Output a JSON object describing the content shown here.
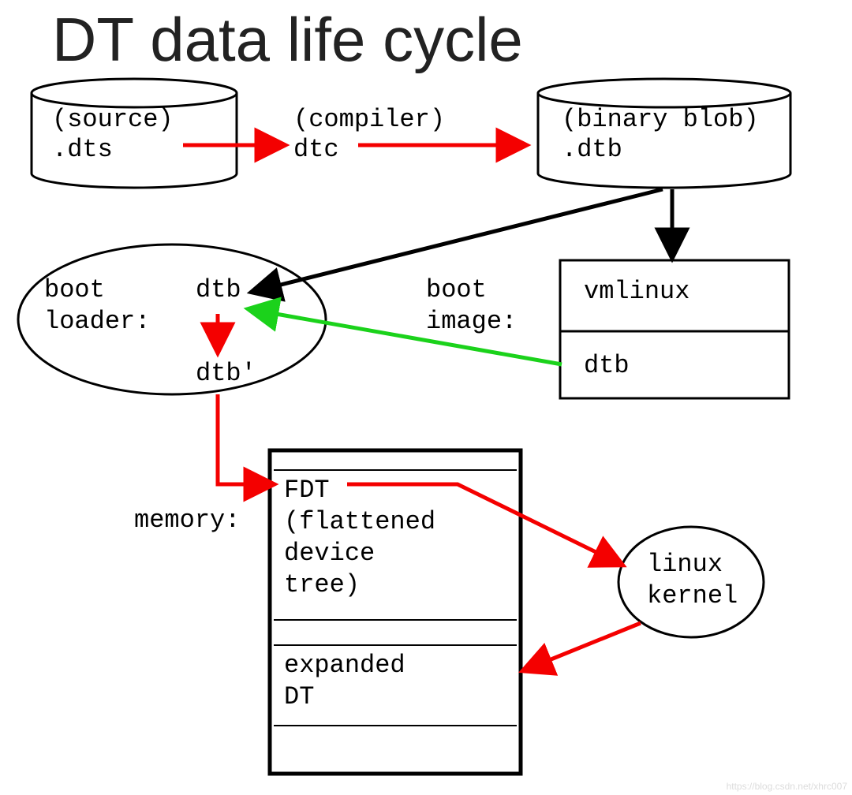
{
  "title": "DT data life cycle",
  "cyl_source": {
    "line1": "(source)",
    "line2": ".dts"
  },
  "compiler": {
    "line1": "(compiler)",
    "line2": "dtc"
  },
  "cyl_binary": {
    "line1": "(binary blob)",
    "line2": ".dtb"
  },
  "bootloader": {
    "label": "boot\nloader:",
    "dtb": "dtb",
    "dtbp": "dtb'"
  },
  "bootimage": {
    "label": "boot\nimage:",
    "vmlinux": "vmlinux",
    "dtb": "dtb"
  },
  "memory": {
    "label": "memory:",
    "fdt": "FDT\n(flattened\ndevice\ntree)",
    "expanded": "expanded\nDT"
  },
  "kernel": "linux\nkernel",
  "watermark": "https://blog.csdn.net/xhrc007"
}
